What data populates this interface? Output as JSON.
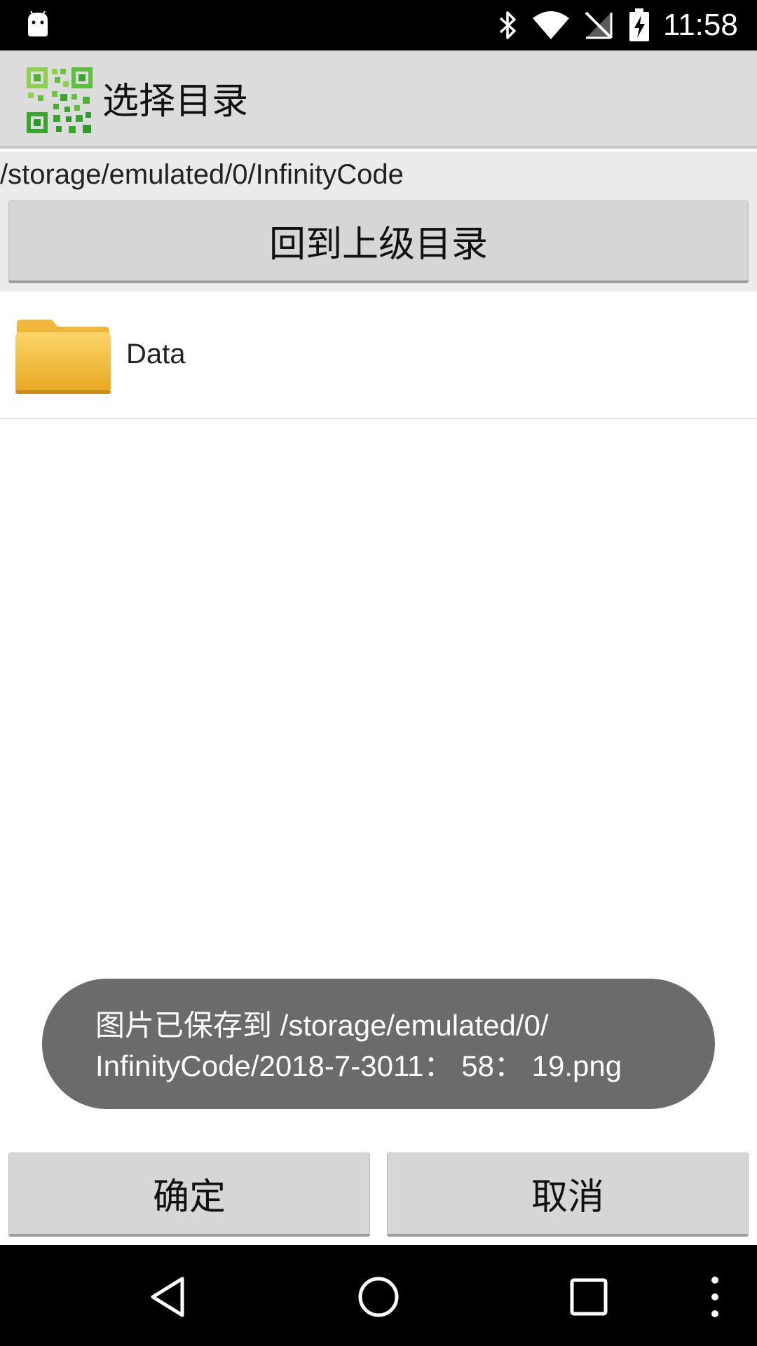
{
  "status_bar": {
    "time": "11:58",
    "icons": [
      "android-icon",
      "bluetooth-icon",
      "wifi-icon",
      "no-signal-icon",
      "battery-charging-icon"
    ]
  },
  "title_bar": {
    "icon": "qr-code-icon",
    "title": "选择目录"
  },
  "path_panel": {
    "current_path": "/storage/emulated/0/InfinityCode",
    "up_button_label": "回到上级目录"
  },
  "file_list": {
    "items": [
      {
        "name": "Data",
        "icon": "folder-icon"
      }
    ]
  },
  "toast": {
    "line1": "图片已保存到 /storage/emulated/0/",
    "line2": "InfinityCode/2018-7-3011： 58： 19.png"
  },
  "buttons": {
    "ok_label": "确定",
    "cancel_label": "取消"
  },
  "nav_bar": {
    "icons": [
      "back-icon",
      "home-icon",
      "recents-icon",
      "overflow-menu-icon"
    ]
  },
  "colors": {
    "title_bar_bg": "#dcdcdc",
    "button_bg": "#d6d6d6",
    "toast_bg": "#6b6b6b",
    "folder": "#f2c04a"
  }
}
